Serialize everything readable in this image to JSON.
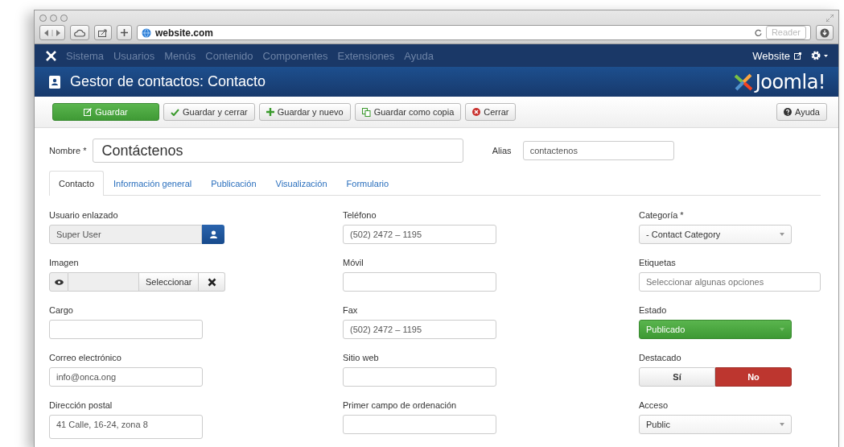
{
  "browser": {
    "url": "website.com",
    "reader": "Reader"
  },
  "nav": {
    "items": [
      {
        "label": "Sistema",
        "disabled": true
      },
      {
        "label": "Usuarios",
        "disabled": true
      },
      {
        "label": "Menús",
        "disabled": true
      },
      {
        "label": "Contenido",
        "disabled": true
      },
      {
        "label": "Componentes",
        "disabled": true
      },
      {
        "label": "Extensiones",
        "disabled": true
      },
      {
        "label": "Ayuda",
        "disabled": true
      }
    ],
    "site_link": "Website"
  },
  "header": {
    "title": "Gestor de contactos: Contacto",
    "logo": "Joomla!"
  },
  "toolbar": {
    "buttons": [
      {
        "label": "Guardar",
        "kind": "primary"
      },
      {
        "label": "Guardar y cerrar",
        "kind": "check"
      },
      {
        "label": "Guardar y nuevo",
        "kind": "plus"
      },
      {
        "label": "Guardar como copia",
        "kind": "copy"
      },
      {
        "label": "Cerrar",
        "kind": "close"
      }
    ],
    "help": "Ayuda"
  },
  "name_field": {
    "label": "Nombre *",
    "value": "Contáctenos"
  },
  "alias_field": {
    "label": "Alias",
    "value": "contactenos"
  },
  "tabs": [
    {
      "label": "Contacto",
      "selected": true
    },
    {
      "label": "Información general",
      "selected": false
    },
    {
      "label": "Publicación",
      "selected": false
    },
    {
      "label": "Visualización",
      "selected": false
    },
    {
      "label": "Formulario",
      "selected": false
    }
  ],
  "columns": [
    {
      "fields": [
        {
          "label": "Usuario enlazado",
          "kind": "user",
          "value": "Super User"
        },
        {
          "label": "Imagen",
          "kind": "media",
          "button": "Seleccionar"
        },
        {
          "label": "Cargo",
          "kind": "text"
        },
        {
          "label": "Correo electrónico",
          "kind": "text",
          "value": "info@onca.ong"
        },
        {
          "label": "Dirección postal",
          "kind": "textarea",
          "value": "41 Calle, 16-24, zona 8"
        }
      ]
    },
    {
      "fields": [
        {
          "label": "Teléfono",
          "kind": "text",
          "value": "(502) 2472 – 1195"
        },
        {
          "label": "Móvil",
          "kind": "text"
        },
        {
          "label": "Fax",
          "kind": "text",
          "value": "(502) 2472 – 1195"
        },
        {
          "label": "Sitio web",
          "kind": "text"
        },
        {
          "label": "Primer campo de ordenación",
          "kind": "text"
        }
      ]
    },
    {
      "fields": [
        {
          "label": "Categoría *",
          "kind": "select",
          "value": "- Contact Category"
        },
        {
          "label": "Etiquetas",
          "kind": "tags",
          "placeholder": "Seleccionar algunas opciones"
        },
        {
          "label": "Estado",
          "kind": "status",
          "value": "Publicado"
        },
        {
          "label": "Destacado",
          "kind": "toggle",
          "options": [
            {
              "label": "Sí",
              "selected": false
            },
            {
              "label": "No",
              "selected": true
            }
          ]
        },
        {
          "label": "Acceso",
          "kind": "select",
          "value": "Public"
        }
      ]
    }
  ]
}
